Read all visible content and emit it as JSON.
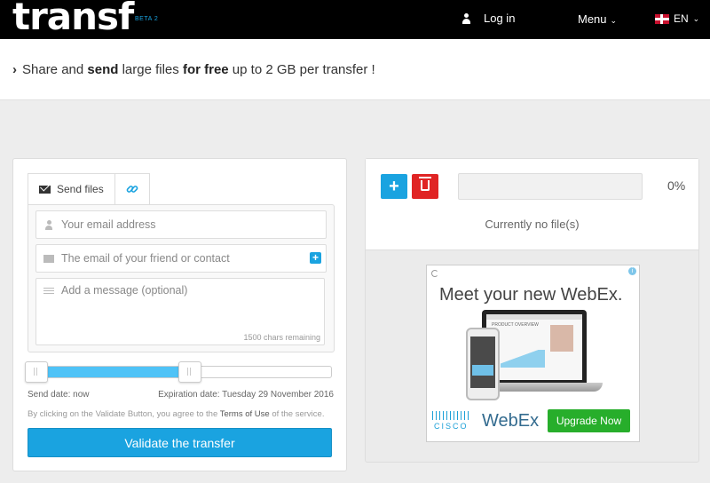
{
  "header": {
    "logo": "transf",
    "beta": "BETA 2",
    "login_label": "Log in",
    "menu_label": "Menu",
    "lang_label": "EN",
    "menu_chevron": "⌄"
  },
  "banner": {
    "part1": "Share and ",
    "bold1": "send",
    "part2": " large files ",
    "bold2": "for free",
    "part3": " up to 2 GB per transfer !"
  },
  "left_panel": {
    "tabs": [
      {
        "label": "Send files",
        "icon": "envelope-icon"
      },
      {
        "label": "",
        "icon": "link-icon"
      }
    ],
    "email_placeholder": "Your email address",
    "friend_placeholder": "The email of your friend or contact",
    "message_placeholder": "Add a message (optional)",
    "chars_remaining": "1500 chars remaining",
    "send_date": "Send date: now",
    "expiration_date": "Expiration date: Tuesday 29 November 2016",
    "terms_prefix": "By clicking on the Validate Button, you agree to the ",
    "terms_link": "Terms of Use",
    "terms_suffix": " of the service.",
    "validate_label": "Validate the transfer",
    "slider_fill_fraction": 0.53
  },
  "right_panel": {
    "add_label": "+",
    "progress_percent": "0%",
    "progress_value": 0,
    "no_files": "Currently no file(s)"
  },
  "ad": {
    "headline": "Meet your new WebEx.",
    "info": "i",
    "cisco": "CISCO",
    "webex": "WebEx",
    "upgrade": "Upgrade Now",
    "screen_title": "PRODUCT OVERVIEW"
  },
  "colors": {
    "accent": "#1aa3e0",
    "danger": "#e02424",
    "upgrade_green": "#27ae2b"
  }
}
